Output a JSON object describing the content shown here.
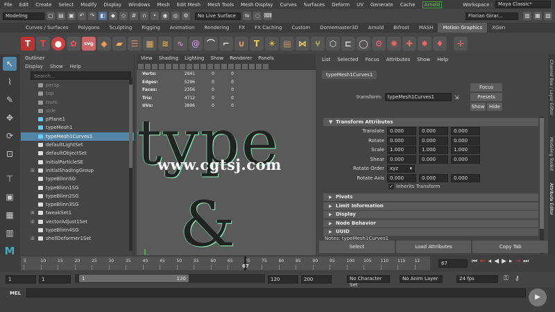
{
  "menubar": {
    "items": [
      "File",
      "Edit",
      "Create",
      "Select",
      "Modify",
      "Display",
      "Windows",
      "Mesh",
      "Edit Mesh",
      "Mesh Tools",
      "Mesh Display",
      "Curves",
      "Surfaces",
      "Deform",
      "UV",
      "Generate",
      "Cache"
    ],
    "arnold": "Arnold",
    "workspace_label": "Workspace :",
    "workspace_value": "Maya Classic*"
  },
  "statusline": {
    "mode": "Modeling",
    "live_surface": "No Live Surface",
    "user": "Florian Girar..."
  },
  "shelf": {
    "tabs": [
      "Curves / Surfaces",
      "Polygons",
      "Sculpting",
      "Rigging",
      "Animation",
      "Rendering",
      "FX",
      "FX Caching",
      "Custom",
      "Domemaster3D",
      "Arnold",
      "Bifrost",
      "MASH",
      "Motion Graphics",
      "XGen"
    ],
    "active_tab": "Motion Graphics"
  },
  "outliner": {
    "title": "Outliner",
    "menu": [
      "Display",
      "Show",
      "Help"
    ],
    "search_placeholder": "Search...",
    "items": [
      {
        "label": "persp",
        "dim": true,
        "icon": "camera-icon"
      },
      {
        "label": "top",
        "dim": true,
        "icon": "camera-icon"
      },
      {
        "label": "front",
        "dim": true,
        "icon": "camera-icon"
      },
      {
        "label": "side",
        "dim": true,
        "icon": "camera-icon"
      },
      {
        "label": "pPlane1",
        "icon": "mesh-icon"
      },
      {
        "label": "typeMesh1",
        "icon": "mesh-icon"
      },
      {
        "label": "typeMesh1Curves1",
        "icon": "curve-icon",
        "selected": true
      },
      {
        "label": "defaultLightSet",
        "icon": "set-icon"
      },
      {
        "label": "defaultObjectSet",
        "icon": "set-icon"
      },
      {
        "label": "initialParticleSE",
        "icon": "set-icon"
      },
      {
        "label": "initialShadingGroup",
        "icon": "set-icon",
        "expand": true
      },
      {
        "label": "typeBlinnSG",
        "icon": "set-icon"
      },
      {
        "label": "typeBlinn1SG",
        "icon": "set-icon"
      },
      {
        "label": "typeBlinn2SG",
        "icon": "set-icon"
      },
      {
        "label": "typeBlinn3SG",
        "icon": "set-icon"
      },
      {
        "label": "tweakSet1",
        "icon": "set-icon",
        "expand": true
      },
      {
        "label": "vectorAdjust1Set",
        "icon": "set-icon",
        "expand": true
      },
      {
        "label": "typeBlinn4SG",
        "icon": "set-icon"
      },
      {
        "label": "shellDeformer1Set",
        "icon": "set-icon",
        "expand": true
      }
    ]
  },
  "viewport": {
    "menu": [
      "View",
      "Shading",
      "Lighting",
      "Show",
      "Renderer",
      "Panels"
    ],
    "hud": [
      {
        "key": "Verts:",
        "a": "2941",
        "b": "0",
        "c": "0"
      },
      {
        "key": "Edges:",
        "a": "5296",
        "b": "0",
        "c": "0"
      },
      {
        "key": "Faces:",
        "a": "2356",
        "b": "0",
        "c": "0"
      },
      {
        "key": "Tris:",
        "a": "4712",
        "b": "0",
        "c": "0"
      },
      {
        "key": "UVs:",
        "a": "3896",
        "b": "0",
        "c": "0"
      }
    ],
    "scene_text": "type",
    "scene_amp": "&",
    "watermark": "www.cgtsj.com",
    "camera_label": "persp"
  },
  "attr": {
    "menu": [
      "List",
      "Selected",
      "Focus",
      "Attributes",
      "Show",
      "Help"
    ],
    "tab": "typeMesh1Curves1",
    "transform_label": "transform:",
    "transform_value": "typeMesh1Curves1",
    "focus": "Focus",
    "presets": "Presets",
    "show": "Show",
    "hide": "Hide",
    "section_transform": "Transform Attributes",
    "rows": [
      {
        "label": "Translate",
        "v": [
          "0.000",
          "0.000",
          "0.000"
        ]
      },
      {
        "label": "Rotate",
        "v": [
          "0.000",
          "0.000",
          "0.000"
        ]
      },
      {
        "label": "Scale",
        "v": [
          "1.000",
          "1.000",
          "1.000"
        ]
      },
      {
        "label": "Shear",
        "v": [
          "0.000",
          "0.000",
          "0.000"
        ]
      }
    ],
    "rotate_order_label": "Rotate Order",
    "rotate_order_value": "xyz",
    "rotate_axis_label": "Rotate Axis",
    "rotate_axis": [
      "0.000",
      "0.000",
      "0.000"
    ],
    "inherits": "Inherits Transform",
    "sections": [
      "Pivots",
      "Limit Information",
      "Display",
      "Node Behavior",
      "UUID"
    ],
    "notes": "Notes: typeMesh1Curves1",
    "buttons": [
      "Select",
      "Load Attributes",
      "Copy Tab"
    ]
  },
  "sidetabs": [
    "Channel Box / Layer Editor",
    "Modeling Toolkit",
    "Attribute Editor"
  ],
  "timeline": {
    "ticks": [
      "5",
      "10",
      "15",
      "20",
      "25",
      "30",
      "35",
      "40",
      "45",
      "50",
      "55",
      "60",
      "65",
      "70",
      "75",
      "80",
      "85",
      "90",
      "95",
      "100",
      "105",
      "110",
      "115",
      "12"
    ],
    "current_frame": "67",
    "frame_field": "67"
  },
  "range": {
    "start": "1",
    "start2": "1",
    "thumb_start": "1",
    "thumb_end": "120",
    "end": "120",
    "end2": "200",
    "character_set": "No Character Set",
    "anim_layer": "No Anim Layer",
    "fps": "24 fps"
  },
  "command": {
    "label": "MEL"
  },
  "colors": {
    "selection": "#5285a6",
    "accent_green": "#7c7"
  }
}
